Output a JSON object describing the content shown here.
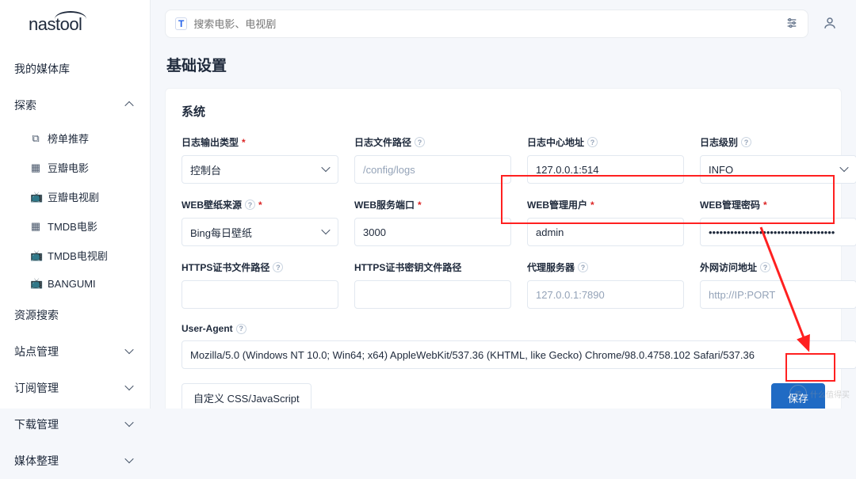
{
  "brand": "nastool",
  "search": {
    "badge": "T",
    "placeholder": "搜索电影、电视剧"
  },
  "sidebar": {
    "media_lib": "我的媒体库",
    "explore": {
      "label": "探索",
      "items": [
        {
          "icon": "⧉",
          "label": "榜单推荐"
        },
        {
          "icon": "▦",
          "label": "豆瓣电影"
        },
        {
          "icon": "📺",
          "label": "豆瓣电视剧"
        },
        {
          "icon": "▦",
          "label": "TMDB电影"
        },
        {
          "icon": "📺",
          "label": "TMDB电视剧"
        },
        {
          "icon": "📺",
          "label": "BANGUMI"
        }
      ]
    },
    "groups": [
      "资源搜索",
      "站点管理",
      "订阅管理",
      "下载管理",
      "媒体整理"
    ]
  },
  "page": {
    "title": "基础设置",
    "section": "系统"
  },
  "form": {
    "log_output_type": {
      "label": "日志输出类型",
      "value": "控制台"
    },
    "log_file_path": {
      "label": "日志文件路径",
      "placeholder": "/config/logs"
    },
    "log_center_addr": {
      "label": "日志中心地址",
      "value": "127.0.0.1:514"
    },
    "log_level": {
      "label": "日志级别",
      "value": "INFO"
    },
    "wallpaper_source": {
      "label": "WEB壁纸来源",
      "value": "Bing每日壁纸"
    },
    "web_port": {
      "label": "WEB服务端口",
      "value": "3000"
    },
    "web_user": {
      "label": "WEB管理用户",
      "value": "admin"
    },
    "web_password": {
      "label": "WEB管理密码",
      "value": "•••••••••••••••••••••••••••••••••••"
    },
    "https_cert": {
      "label": "HTTPS证书文件路径"
    },
    "https_key": {
      "label": "HTTPS证书密钥文件路径"
    },
    "proxy": {
      "label": "代理服务器",
      "placeholder": "127.0.0.1:7890"
    },
    "external_url": {
      "label": "外网访问地址",
      "placeholder": "http://IP:PORT"
    },
    "user_agent": {
      "label": "User-Agent",
      "value": "Mozilla/5.0 (Windows NT 10.0; Win64; x64) AppleWebKit/537.36 (KHTML, like Gecko) Chrome/98.0.4758.102 Safari/537.36"
    }
  },
  "buttons": {
    "custom": "自定义 CSS/JavaScript",
    "save": "保存"
  },
  "watermark": {
    "badge": "值",
    "text": "什么值得买"
  }
}
